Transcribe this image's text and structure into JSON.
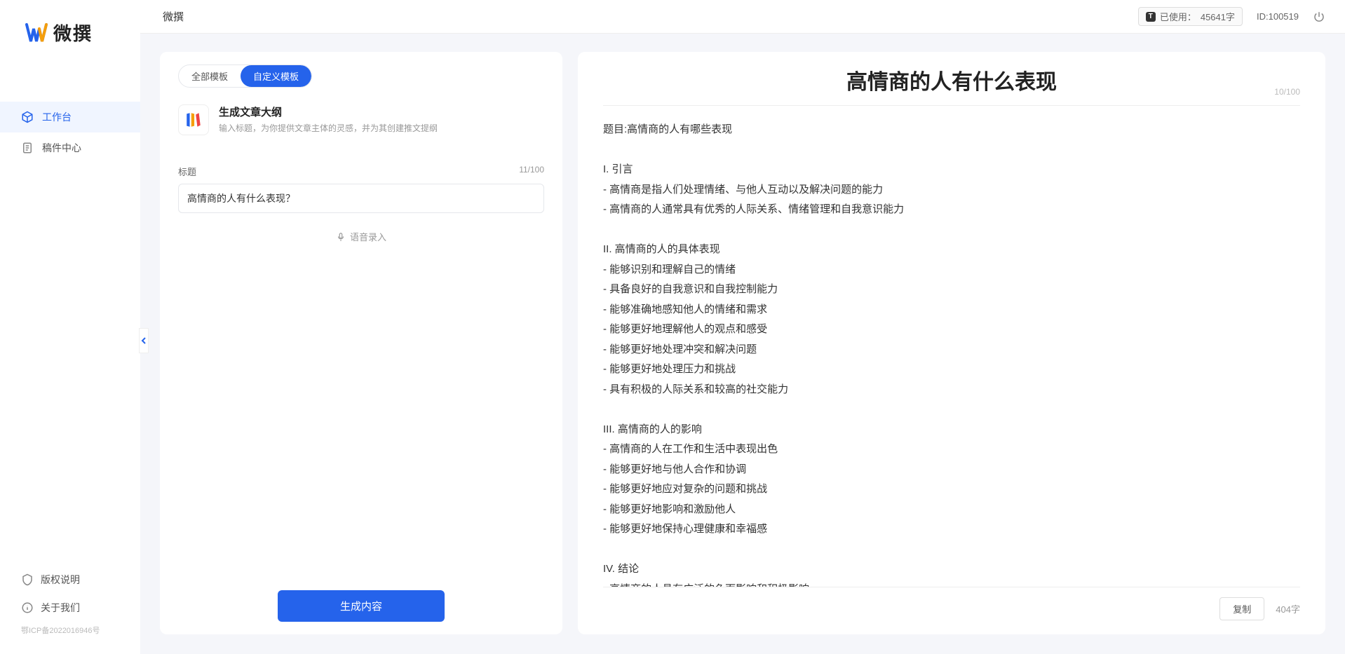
{
  "app": {
    "name": "微撰",
    "icp": "鄂ICP备2022016946号"
  },
  "sidebar": {
    "nav": [
      {
        "label": "工作台",
        "icon": "cube"
      },
      {
        "label": "稿件中心",
        "icon": "doc"
      }
    ],
    "bottom": [
      {
        "label": "版权说明",
        "icon": "shield"
      },
      {
        "label": "关于我们",
        "icon": "info"
      }
    ]
  },
  "topbar": {
    "title": "微撰",
    "usage_prefix": "已使用：",
    "usage_value": "45641字",
    "id_label": "ID:100519"
  },
  "left": {
    "tabs": {
      "all": "全部模板",
      "custom": "自定义模板"
    },
    "template": {
      "title": "生成文章大纲",
      "desc": "输入标题，为你提供文章主体的灵感，并为其创建推文提纲"
    },
    "field_label": "标题",
    "field_count": "11/100",
    "title_value": "高情商的人有什么表现？",
    "voice_label": "语音录入",
    "generate": "生成内容"
  },
  "right": {
    "title": "高情商的人有什么表现",
    "title_count": "10/100",
    "body": "题目:高情商的人有哪些表现\n\nI. 引言\n- 高情商是指人们处理情绪、与他人互动以及解决问题的能力\n- 高情商的人通常具有优秀的人际关系、情绪管理和自我意识能力\n\nII. 高情商的人的具体表现\n- 能够识别和理解自己的情绪\n- 具备良好的自我意识和自我控制能力\n- 能够准确地感知他人的情绪和需求\n- 能够更好地理解他人的观点和感受\n- 能够更好地处理冲突和解决问题\n- 能够更好地处理压力和挑战\n- 具有积极的人际关系和较高的社交能力\n\nIII. 高情商的人的影响\n- 高情商的人在工作和生活中表现出色\n- 能够更好地与他人合作和协调\n- 能够更好地应对复杂的问题和挑战\n- 能够更好地影响和激励他人\n- 能够更好地保持心理健康和幸福感\n\nIV. 结论\n- 高情商的人具有广泛的负面影响和积极影响\n- 高情商的能力是可以通过学习和练习获得的\n- 培养和提高高情商的能力对于个人的职业发展和生活质量至关重要。",
    "copy": "复制",
    "char_count": "404字"
  }
}
